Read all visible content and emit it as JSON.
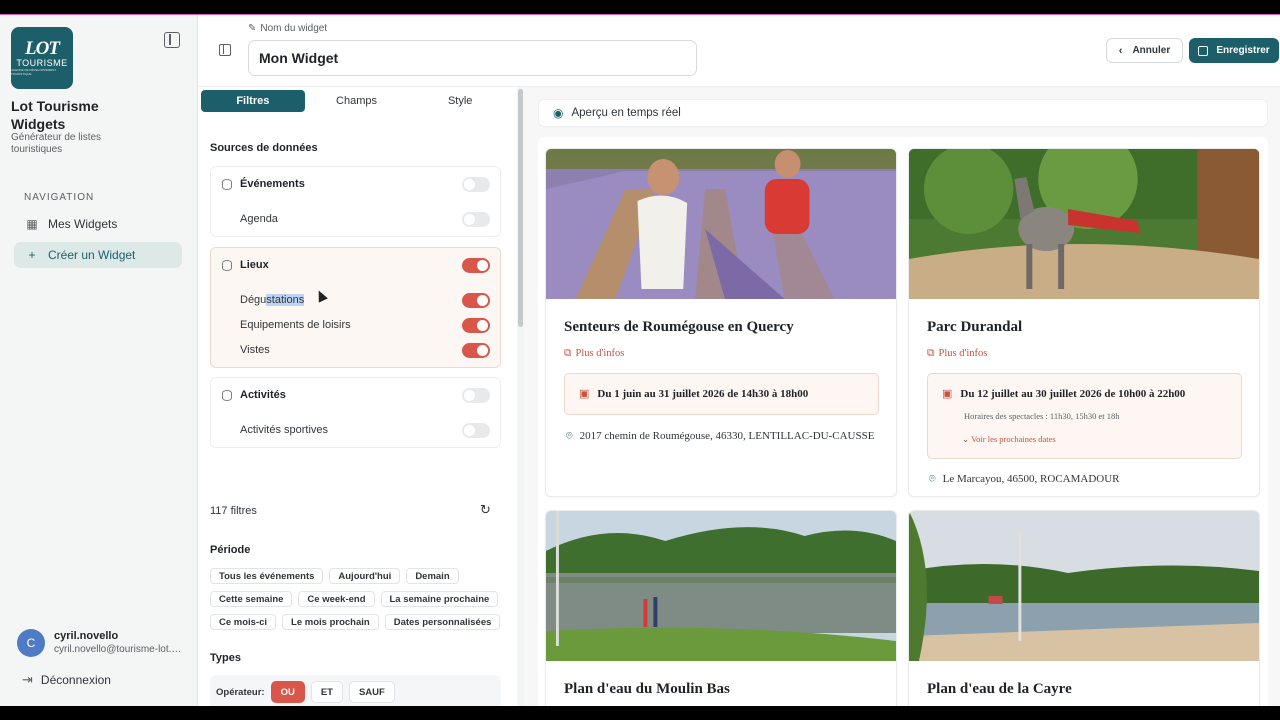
{
  "sidebar": {
    "logo": {
      "line1": "LOT",
      "line2": "TOURISME",
      "line3": "AGENCE DE DÉVELOPPEMENT TOURISTIQUE"
    },
    "app_title": "Lot Tourisme Widgets",
    "app_subtitle": "Générateur de listes touristiques",
    "nav_heading": "NAVIGATION",
    "nav_items": [
      {
        "label": "Mes Widgets",
        "icon": "grid-icon"
      },
      {
        "label": "Créer un Widget",
        "icon": "plus-icon"
      }
    ],
    "user": {
      "initial": "C",
      "name": "cyril.novello",
      "email": "cyril.novello@tourisme-lot.com"
    },
    "logout_label": "Déconnexion"
  },
  "header": {
    "widget_name_label": "Nom du widget",
    "widget_name_value": "Mon Widget",
    "cancel_label": "Annuler",
    "save_label": "Enregistrer"
  },
  "panel": {
    "tabs": [
      "Filtres",
      "Champs",
      "Style"
    ],
    "sources_title": "Sources de données",
    "sources": [
      {
        "name": "Événements",
        "enabled": false,
        "children": [
          {
            "name": "Agenda",
            "enabled": false
          }
        ]
      },
      {
        "name": "Lieux",
        "enabled": true,
        "children": [
          {
            "name_prefix": "Dégu",
            "name_selected": "stations",
            "enabled": true
          },
          {
            "name": "Equipements de loisirs",
            "enabled": true
          },
          {
            "name": "Vistes",
            "enabled": true
          }
        ]
      },
      {
        "name": "Activités",
        "enabled": false,
        "children": [
          {
            "name": "Activités sportives",
            "enabled": false
          }
        ]
      }
    ],
    "filters_count": "117 filtres",
    "period_title": "Période",
    "period_chips": [
      "Tous les événements",
      "Aujourd'hui",
      "Demain",
      "Cette semaine",
      "Ce week-end",
      "La semaine prochaine",
      "Ce mois-ci",
      "Le mois prochain",
      "Dates personnalisées"
    ],
    "types_title": "Types",
    "operator_label": "Opérateur:",
    "operators": [
      "OU",
      "ET",
      "SAUF"
    ],
    "operator_selected": "OU"
  },
  "preview": {
    "bar_label": "Aperçu en temps réel",
    "more_info_label": "Plus d'infos",
    "cards": [
      {
        "title": "Senteurs de Roumégouse en Quercy",
        "dates": "Du 1 juin au 31 juillet 2026 de 14h30 à 18h00",
        "address": "2017 chemin de Roumégouse, 46330, LENTILLAC-DU-CAUSSE"
      },
      {
        "title": "Parc Durandal",
        "dates": "Du 12 juillet au 30 juillet 2026 de 10h00 à 22h00",
        "hours_note": "Horaires des spectacles : 11h30, 15h30 et 18h",
        "next_dates_label": "Voir les prochaines dates",
        "address": "Le Marcayou, 46500, ROCAMADOUR"
      },
      {
        "title": "Plan d'eau du Moulin Bas"
      },
      {
        "title": "Plan d'eau de la Cayre"
      }
    ]
  },
  "colors": {
    "brand": "#1c5f6a",
    "accent": "#d9574a",
    "link": "#c8533f"
  }
}
